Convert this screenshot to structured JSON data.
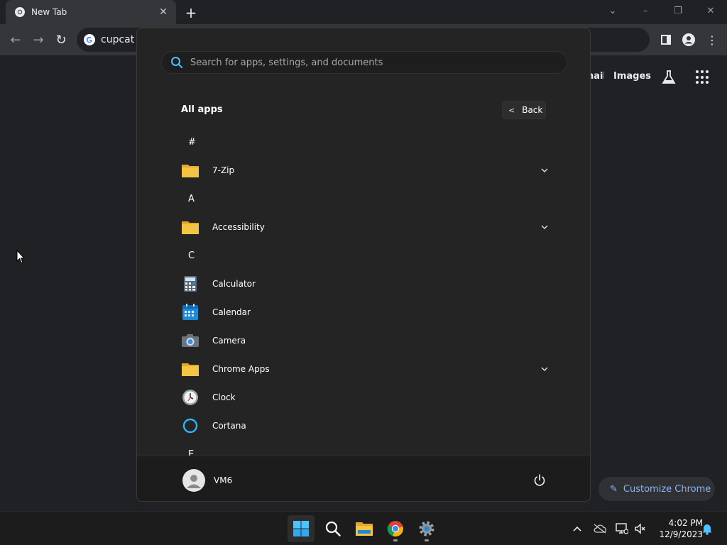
{
  "browser": {
    "tab_title": "New Tab",
    "address_text": "cupcat",
    "gbar_links": [
      "nail",
      "Images"
    ],
    "customize_label": "Customize Chrome"
  },
  "start_menu": {
    "search_placeholder": "Search for apps, settings, and documents",
    "section_title": "All apps",
    "back_label": "Back",
    "items": [
      {
        "kind": "letter",
        "text": "#"
      },
      {
        "kind": "app",
        "text": "7-Zip",
        "icon": "folder-icon",
        "expandable": true
      },
      {
        "kind": "letter",
        "text": "A"
      },
      {
        "kind": "app",
        "text": "Accessibility",
        "icon": "folder-icon",
        "expandable": true
      },
      {
        "kind": "letter",
        "text": "C"
      },
      {
        "kind": "app",
        "text": "Calculator",
        "icon": "calculator-icon",
        "expandable": false
      },
      {
        "kind": "app",
        "text": "Calendar",
        "icon": "calendar-icon",
        "expandable": false
      },
      {
        "kind": "app",
        "text": "Camera",
        "icon": "camera-icon",
        "expandable": false
      },
      {
        "kind": "app",
        "text": "Chrome Apps",
        "icon": "folder-icon",
        "expandable": true
      },
      {
        "kind": "app",
        "text": "Clock",
        "icon": "clock-icon",
        "expandable": false
      },
      {
        "kind": "app",
        "text": "Cortana",
        "icon": "cortana-icon",
        "expandable": false
      },
      {
        "kind": "letter",
        "text": "E"
      }
    ],
    "user_name": "VM6"
  },
  "taskbar": {
    "time": "4:02 PM",
    "date": "12/9/2023",
    "apps": [
      "start-icon",
      "search-icon",
      "file-explorer-icon",
      "chrome-icon",
      "settings-icon"
    ]
  },
  "colors": {
    "accent_blue": "#8ab4f8",
    "folder_yellow": "#f4c542",
    "windows_blue": "#2fb3f5"
  }
}
